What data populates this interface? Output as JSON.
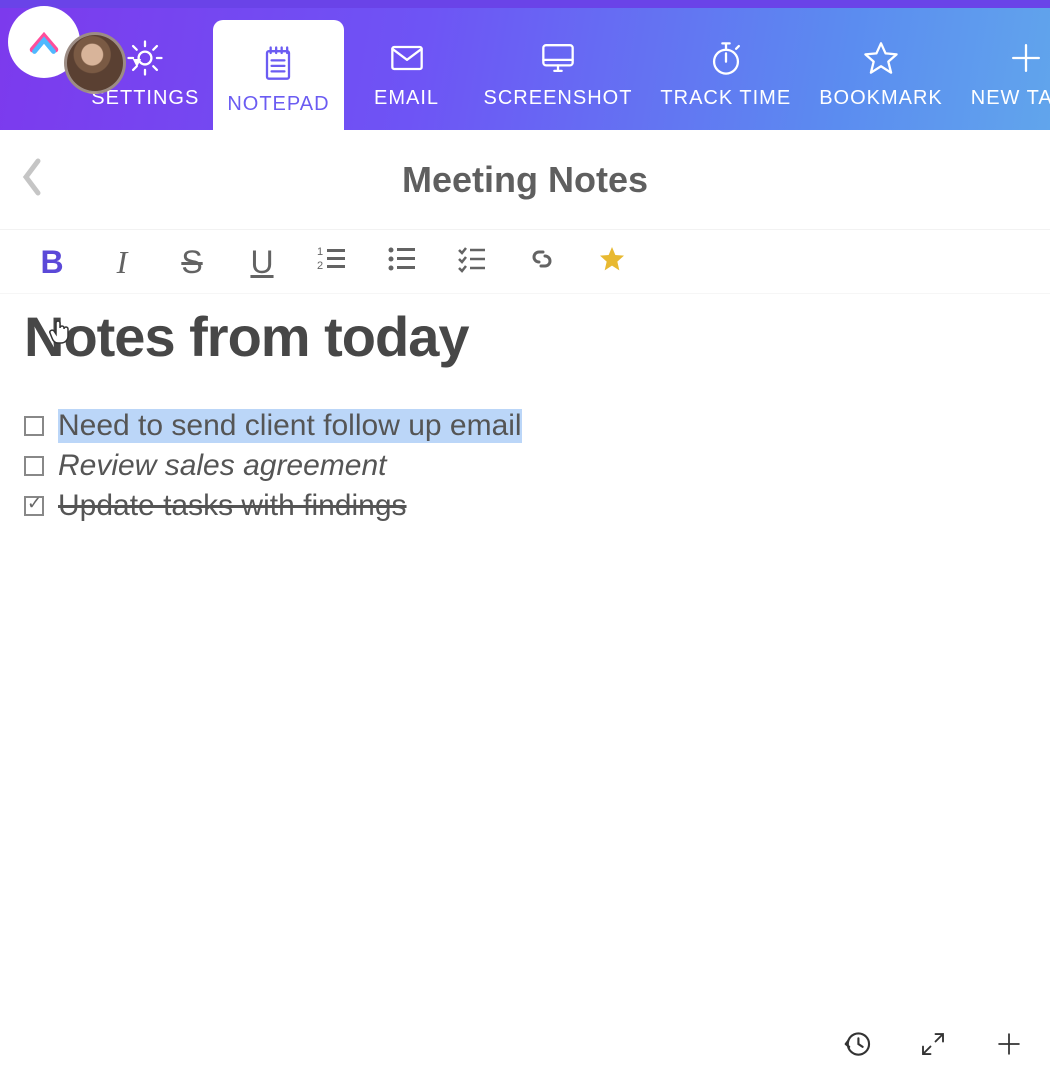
{
  "nav": {
    "tabs": [
      {
        "id": "settings",
        "label": "SETTINGS",
        "icon": "gear-icon",
        "active": false
      },
      {
        "id": "notepad",
        "label": "NOTEPAD",
        "icon": "notepad-icon",
        "active": true
      },
      {
        "id": "email",
        "label": "EMAIL",
        "icon": "envelope-icon",
        "active": false
      },
      {
        "id": "screenshot",
        "label": "SCREENSHOT",
        "icon": "monitor-icon",
        "active": false
      },
      {
        "id": "tracktime",
        "label": "TRACK TIME",
        "icon": "stopwatch-icon",
        "active": false
      },
      {
        "id": "bookmark",
        "label": "BOOKMARK",
        "icon": "star-icon",
        "active": false
      },
      {
        "id": "newtask",
        "label": "NEW TASK",
        "icon": "plus-icon",
        "active": false
      }
    ]
  },
  "titlebar": {
    "document_title": "Meeting Notes"
  },
  "format_toolbar": {
    "buttons": [
      {
        "id": "bold",
        "name": "bold-button",
        "glyph": "B",
        "active": true
      },
      {
        "id": "italic",
        "name": "italic-button",
        "glyph": "I"
      },
      {
        "id": "strike",
        "name": "strikethrough-button",
        "glyph": "S"
      },
      {
        "id": "underline",
        "name": "underline-button",
        "glyph": "U"
      },
      {
        "id": "ordered",
        "name": "ordered-list-button",
        "icon": "ordered-list-icon"
      },
      {
        "id": "bullet",
        "name": "bullet-list-button",
        "icon": "bullet-list-icon"
      },
      {
        "id": "checklist",
        "name": "checklist-button",
        "icon": "checklist-icon"
      },
      {
        "id": "link",
        "name": "link-button",
        "icon": "link-icon"
      },
      {
        "id": "favorite",
        "name": "favorite-button",
        "icon": "star-filled-icon",
        "starred": true
      }
    ]
  },
  "content": {
    "heading": "Notes from today",
    "items": [
      {
        "text": "Need to send client follow up email",
        "checked": false,
        "selected": true,
        "italic": false,
        "strike": false
      },
      {
        "text": "Review sales agreement",
        "checked": false,
        "selected": false,
        "italic": true,
        "strike": false
      },
      {
        "text": "Update tasks with findings",
        "checked": true,
        "selected": false,
        "italic": false,
        "strike": true
      }
    ]
  },
  "footer": {
    "buttons": [
      {
        "id": "history",
        "name": "history-button",
        "icon": "history-icon"
      },
      {
        "id": "expand",
        "name": "expand-button",
        "icon": "expand-icon"
      },
      {
        "id": "add",
        "name": "add-button",
        "icon": "plus-icon"
      }
    ]
  }
}
